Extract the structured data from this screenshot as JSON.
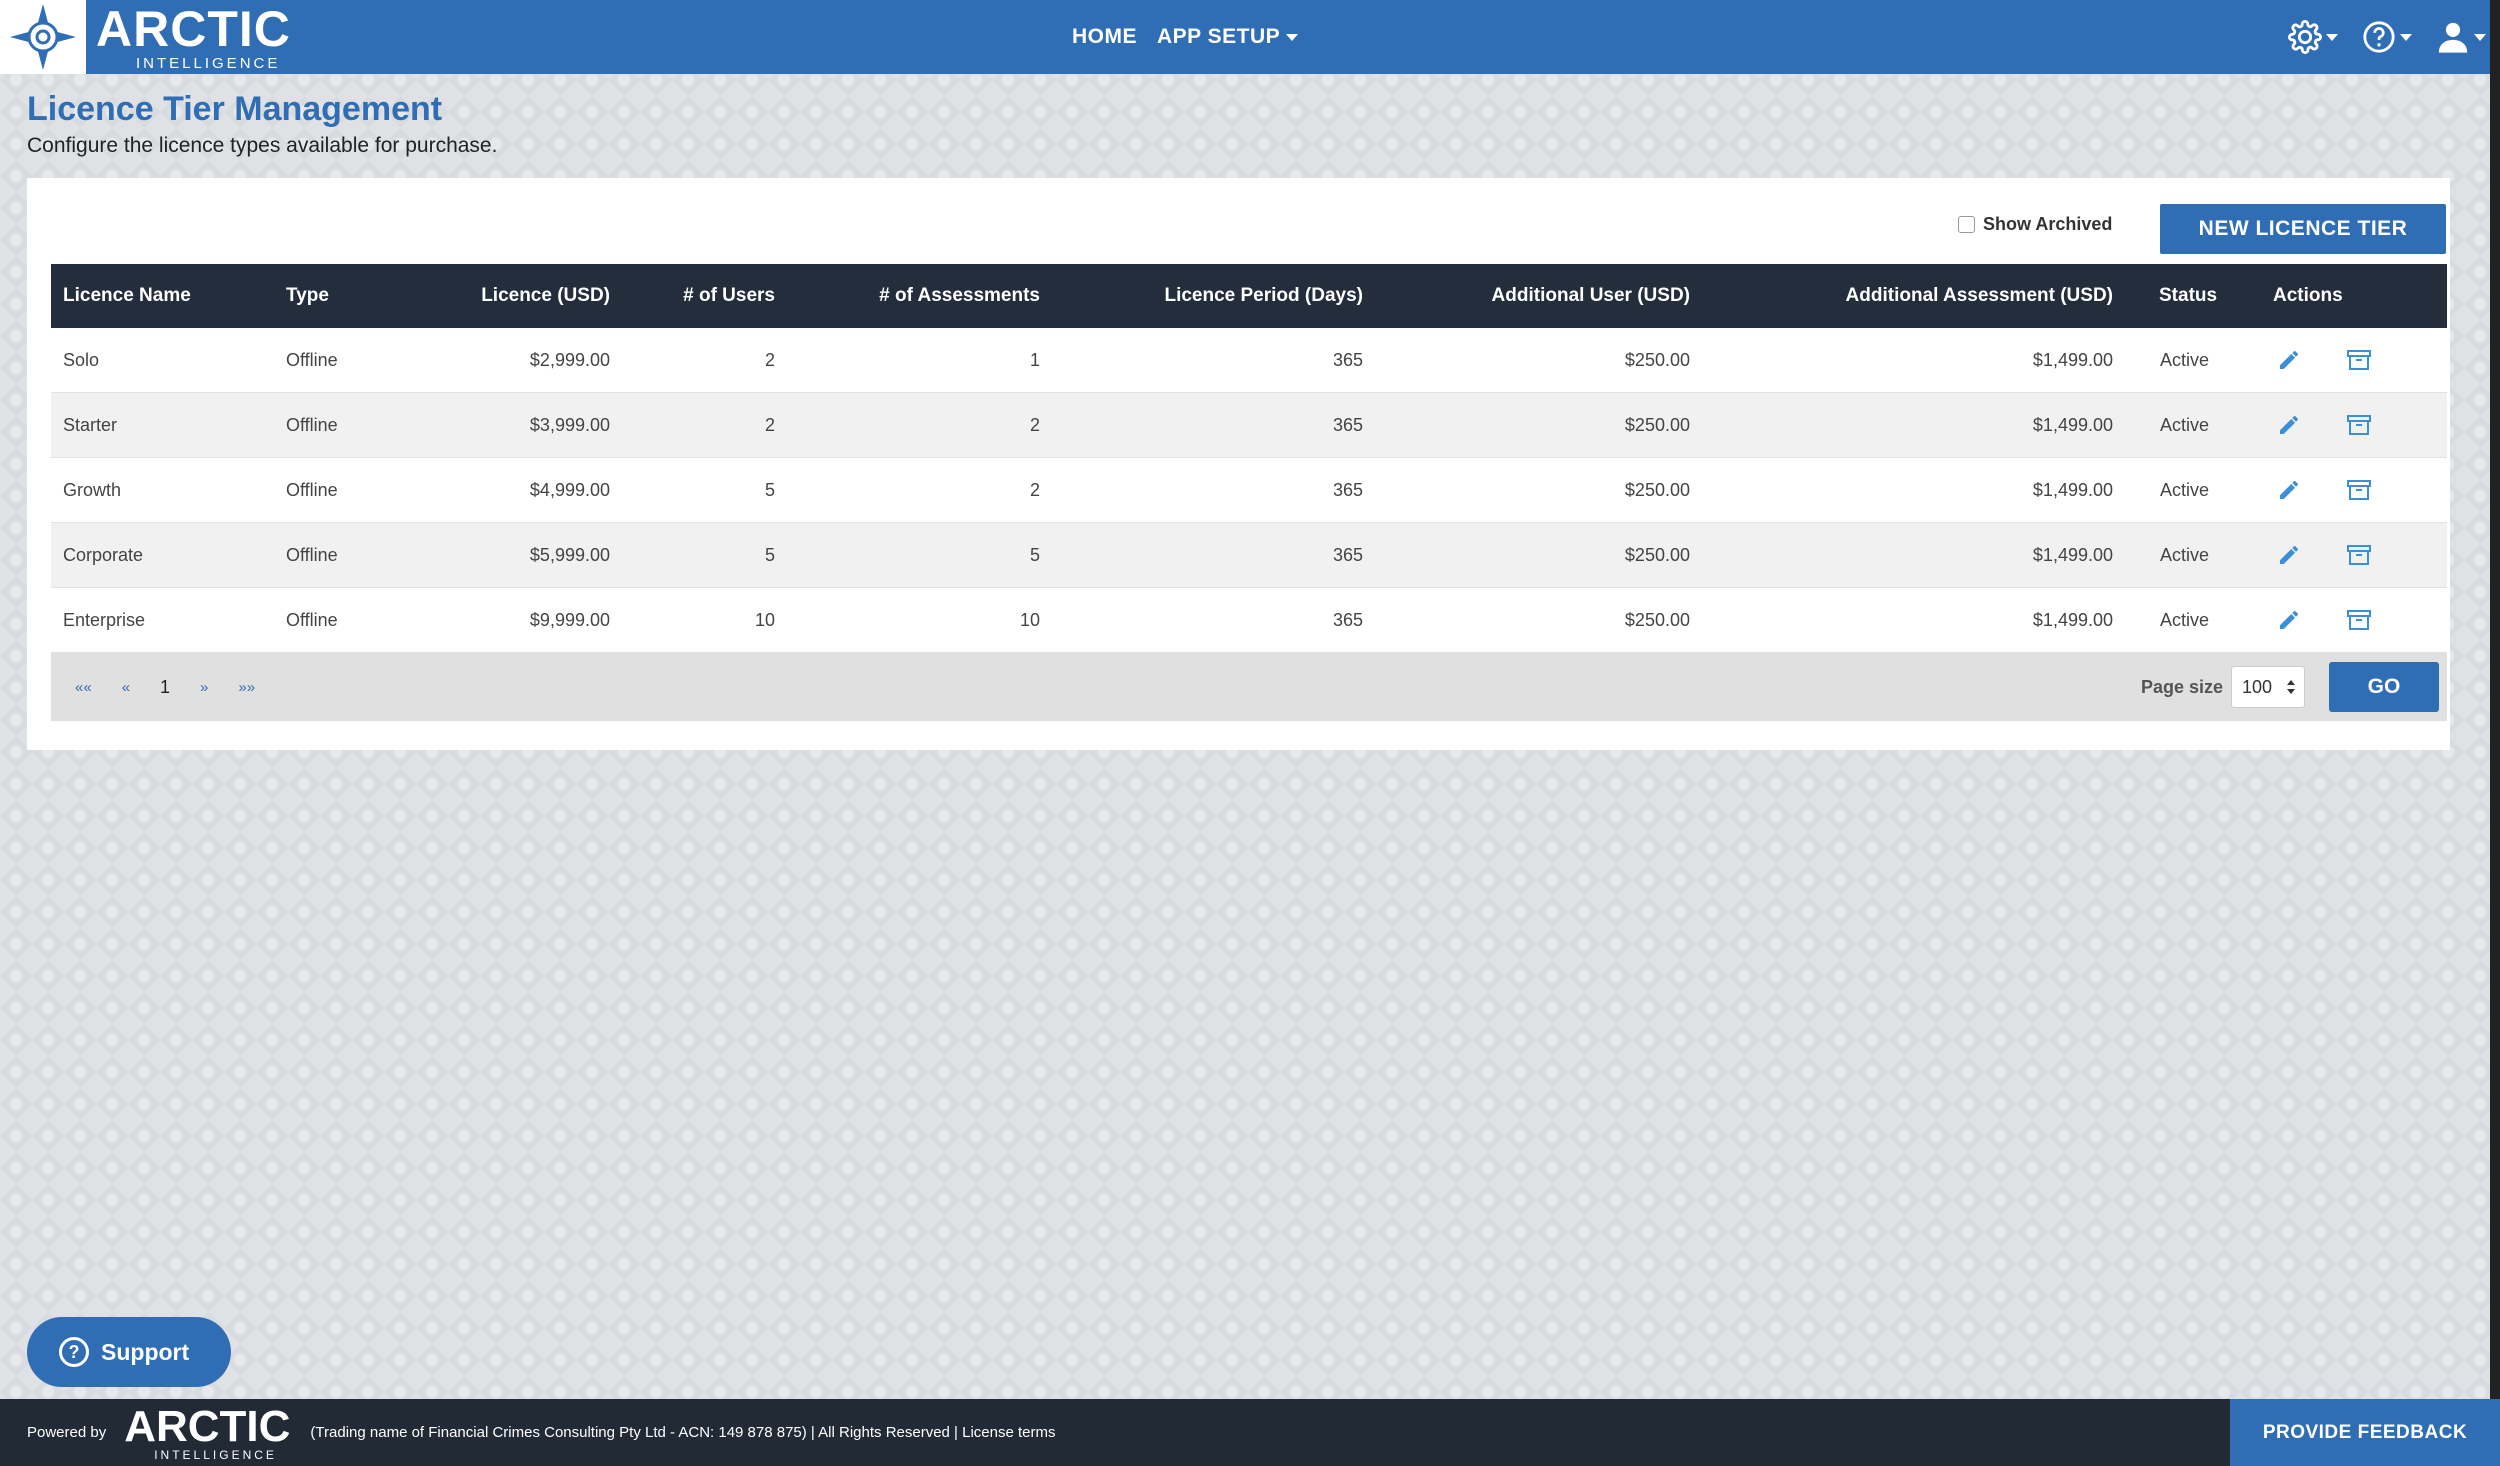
{
  "header": {
    "logo_main": "ARCTIC",
    "logo_sub": "INTELLIGENCE",
    "nav": [
      {
        "label": "HOME"
      },
      {
        "label": "APP SETUP"
      }
    ],
    "icons": [
      "gear-icon",
      "help-icon",
      "user-icon"
    ],
    "accent_color": "#2f6db5"
  },
  "page": {
    "title": "Licence Tier Management",
    "subtitle": "Configure the licence types available for purchase."
  },
  "toolbar": {
    "show_archived_label": "Show Archived",
    "new_button_label": "NEW LICENCE TIER"
  },
  "table": {
    "headers": [
      "Licence Name",
      "Type",
      "Licence (USD)",
      "# of Users",
      "# of Assessments",
      "Licence Period (Days)",
      "Additional User (USD)",
      "Additional Assessment (USD)",
      "Status",
      "Actions"
    ],
    "rows": [
      {
        "name": "Solo",
        "type": "Offline",
        "licence": "$2,999.00",
        "users": "2",
        "assessments": "1",
        "period": "365",
        "add_user": "$250.00",
        "add_assessment": "$1,499.00",
        "status": "Active"
      },
      {
        "name": "Starter",
        "type": "Offline",
        "licence": "$3,999.00",
        "users": "2",
        "assessments": "2",
        "period": "365",
        "add_user": "$250.00",
        "add_assessment": "$1,499.00",
        "status": "Active"
      },
      {
        "name": "Growth",
        "type": "Offline",
        "licence": "$4,999.00",
        "users": "5",
        "assessments": "2",
        "period": "365",
        "add_user": "$250.00",
        "add_assessment": "$1,499.00",
        "status": "Active"
      },
      {
        "name": "Corporate",
        "type": "Offline",
        "licence": "$5,999.00",
        "users": "5",
        "assessments": "5",
        "period": "365",
        "add_user": "$250.00",
        "add_assessment": "$1,499.00",
        "status": "Active"
      },
      {
        "name": "Enterprise",
        "type": "Offline",
        "licence": "$9,999.00",
        "users": "10",
        "assessments": "10",
        "period": "365",
        "add_user": "$250.00",
        "add_assessment": "$1,499.00",
        "status": "Active"
      }
    ]
  },
  "pager": {
    "first": "««",
    "prev": "«",
    "current": "1",
    "next": "»",
    "last": "»»",
    "page_size_label": "Page size",
    "page_size_value": "100",
    "go_label": "GO"
  },
  "support": {
    "label": "Support"
  },
  "footer": {
    "powered_by": "Powered by",
    "logo_main": "ARCTIC",
    "logo_sub": "INTELLIGENCE",
    "legal_text": "(Trading name of Financial Crimes Consulting Pty Ltd - ACN: 149 878 875) | All Rights Reserved | License terms",
    "feedback_label": "PROVIDE FEEDBACK"
  }
}
